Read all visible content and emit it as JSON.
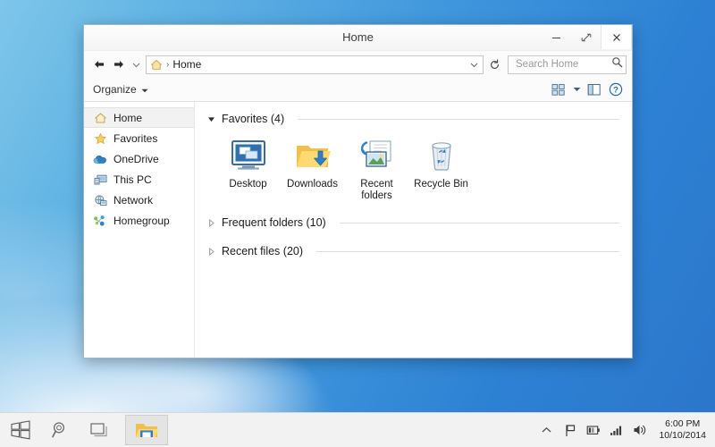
{
  "desktop": {
    "wallpaper_sky_top": "#7ec6ea",
    "wallpaper_sky_bottom": "#2a76cb"
  },
  "window": {
    "title": "Home",
    "controls": {
      "minimize_label": "Minimize",
      "restore_label": "Restore",
      "close_label": "Close"
    },
    "address": {
      "back_label": "Back",
      "forward_label": "Forward",
      "history_label": "Recent locations",
      "breadcrumb_separator": "›",
      "breadcrumb": "Home",
      "dropdown_label": "Previous locations",
      "refresh_label": "Refresh"
    },
    "search": {
      "placeholder": "Search Home",
      "value": ""
    },
    "toolbar": {
      "organize_label": "Organize",
      "view_label": "Change your view",
      "view_dropdown_label": "View options",
      "preview_pane_label": "Preview pane",
      "help_label": "Help"
    }
  },
  "sidebar": {
    "items": [
      {
        "label": "Home",
        "icon": "home-icon",
        "selected": true
      },
      {
        "label": "Favorites",
        "icon": "star-icon",
        "selected": false
      },
      {
        "label": "OneDrive",
        "icon": "cloud-icon",
        "selected": false
      },
      {
        "label": "This PC",
        "icon": "computer-icon",
        "selected": false
      },
      {
        "label": "Network",
        "icon": "network-icon",
        "selected": false
      },
      {
        "label": "Homegroup",
        "icon": "homegroup-icon",
        "selected": false
      }
    ]
  },
  "content": {
    "sections": [
      {
        "title": "Favorites (4)",
        "expanded": true
      },
      {
        "title": "Frequent folders (10)",
        "expanded": false
      },
      {
        "title": "Recent files (20)",
        "expanded": false
      }
    ],
    "favorites": [
      {
        "label": "Desktop",
        "icon": "desktop-monitor-icon"
      },
      {
        "label": "Downloads",
        "icon": "downloads-folder-icon"
      },
      {
        "label": "Recent folders",
        "icon": "recent-folders-icon"
      },
      {
        "label": "Recycle Bin",
        "icon": "recycle-bin-icon"
      }
    ]
  },
  "taskbar": {
    "start_label": "Start",
    "search_label": "Search",
    "task_view_label": "Task View",
    "app_label": "File Explorer",
    "tray": {
      "show_hidden_label": "Show hidden icons",
      "action_center_label": "Action Center",
      "battery_label": "Battery",
      "network_label": "Network",
      "volume_label": "Volume",
      "time": "6:00 PM",
      "date": "10/10/2014"
    }
  }
}
